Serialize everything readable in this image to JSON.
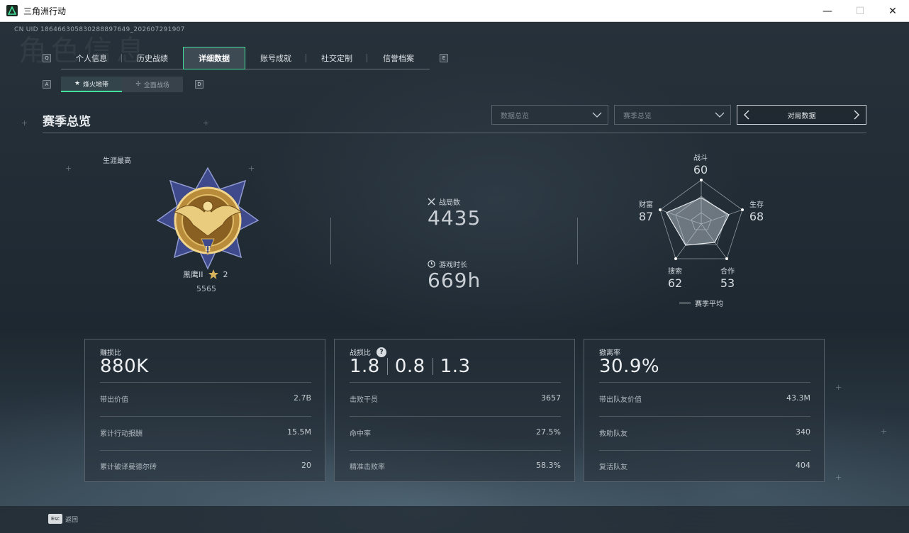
{
  "window": {
    "title": "三角洲行动",
    "controls": {
      "minimize": "—",
      "maximize": "☐",
      "close": "✕"
    }
  },
  "header": {
    "uid": "CN UID 18646630583028889764​9_202607291907",
    "bg_word": "角色信息"
  },
  "keys": {
    "tabs_left": "Q",
    "tabs_right": "E",
    "sub_left": "A",
    "sub_right": "D"
  },
  "tabs": [
    {
      "label": "个人信息"
    },
    {
      "label": "历史战绩"
    },
    {
      "label": "详细数据"
    },
    {
      "label": "账号成就"
    },
    {
      "label": "社交定制"
    },
    {
      "label": "信誉档案"
    }
  ],
  "subtabs": [
    {
      "label": "烽火地带",
      "icon": "★"
    },
    {
      "label": "全面战场",
      "icon": "✢"
    }
  ],
  "section": {
    "title": "赛季总览"
  },
  "filters": {
    "data_dropdown": "数据总览",
    "season_dropdown": "赛季总览",
    "pager_label": "对局数据"
  },
  "career": {
    "label": "生涯最高",
    "rank_name": "黑鹰II",
    "stars": "2",
    "score": "5565"
  },
  "stats": {
    "matches_label": "战局数",
    "matches_value": "4435",
    "playtime_label": "游戏时长",
    "playtime_value": "669h"
  },
  "radar": {
    "axes": [
      {
        "label": "战斗",
        "value": "60"
      },
      {
        "label": "生存",
        "value": "68"
      },
      {
        "label": "合作",
        "value": "53"
      },
      {
        "label": "搜索",
        "value": "62"
      },
      {
        "label": "财富",
        "value": "87"
      }
    ],
    "legend": "赛季平均"
  },
  "cards": {
    "profit": {
      "label": "赚损比",
      "big": "880K",
      "rows": [
        {
          "label": "带出价值",
          "value": "2.7B"
        },
        {
          "label": "累计行动报酬",
          "value": "15.5M"
        },
        {
          "label": "累计破译曼德尔砖",
          "value": "20"
        }
      ]
    },
    "combat": {
      "label": "战损比",
      "help": "?",
      "ratios": [
        "1.8",
        "0.8",
        "1.3"
      ],
      "rows": [
        {
          "label": "击败干员",
          "value": "3657"
        },
        {
          "label": "命中率",
          "value": "27.5%"
        },
        {
          "label": "精准击败率",
          "value": "58.3%"
        }
      ]
    },
    "extract": {
      "label": "撤离率",
      "big": "30.9%",
      "rows": [
        {
          "label": "带出队友价值",
          "value": "43.3M"
        },
        {
          "label": "救助队友",
          "value": "340"
        },
        {
          "label": "复活队友",
          "value": "404"
        }
      ]
    }
  },
  "footer": {
    "esc_key": "Esc",
    "esc_label": "返回"
  },
  "colors": {
    "accent": "#42e29c",
    "gold": "#d7b25a"
  }
}
